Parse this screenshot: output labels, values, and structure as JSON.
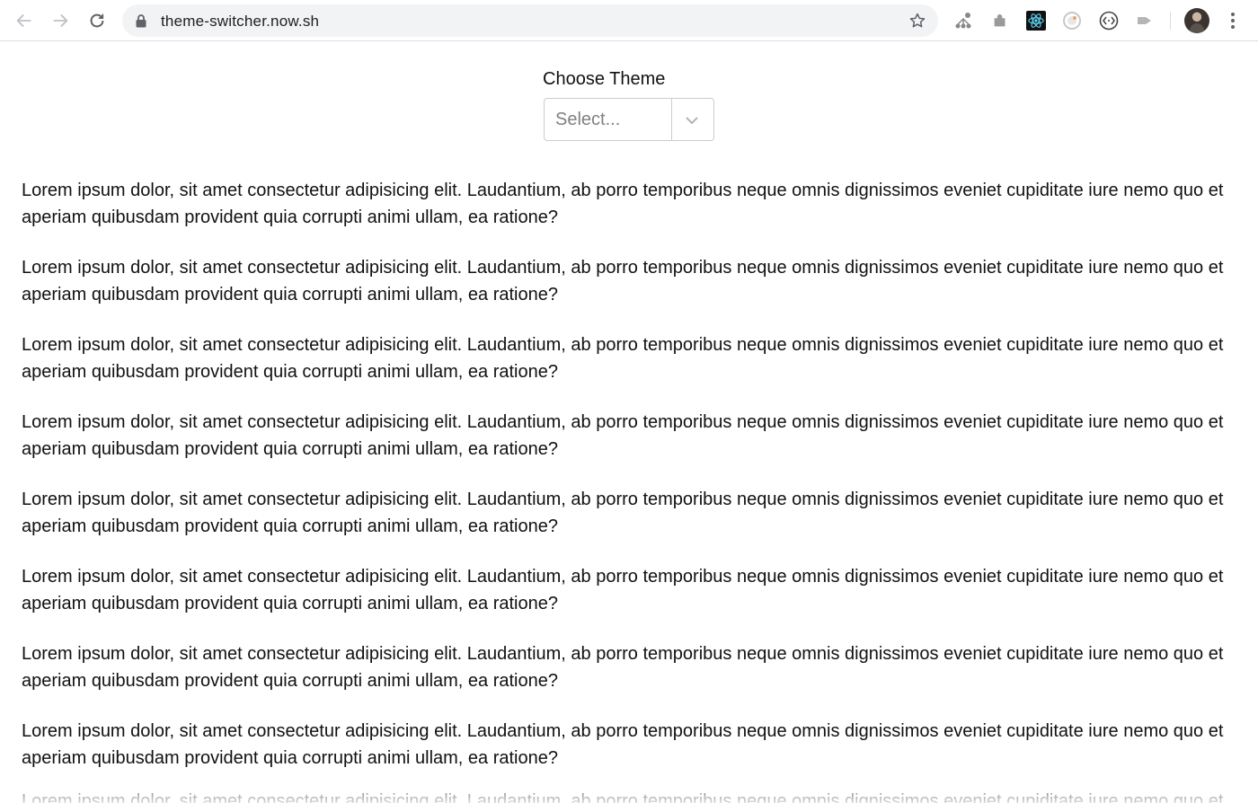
{
  "browser": {
    "url": "theme-switcher.now.sh",
    "icons": {
      "back": "back-arrow-icon",
      "forward": "forward-arrow-icon",
      "reload": "reload-icon",
      "lock": "lock-icon",
      "bookmark": "star-icon",
      "menu": "more-vertical-icon"
    },
    "extensions": [
      "extension-network-icon",
      "extension-puzzle-icon",
      "react-devtools-icon",
      "extension-circle-icon",
      "extension-code-icon",
      "extension-arrow-icon"
    ]
  },
  "theme_picker": {
    "label": "Choose Theme",
    "placeholder": "Select..."
  },
  "content": {
    "paragraphs": [
      "Lorem ipsum dolor, sit amet consectetur adipisicing elit. Laudantium, ab porro temporibus neque omnis dignissimos eveniet cupiditate iure nemo quo et aperiam quibusdam provident quia corrupti animi ullam, ea ratione?",
      "Lorem ipsum dolor, sit amet consectetur adipisicing elit. Laudantium, ab porro temporibus neque omnis dignissimos eveniet cupiditate iure nemo quo et aperiam quibusdam provident quia corrupti animi ullam, ea ratione?",
      "Lorem ipsum dolor, sit amet consectetur adipisicing elit. Laudantium, ab porro temporibus neque omnis dignissimos eveniet cupiditate iure nemo quo et aperiam quibusdam provident quia corrupti animi ullam, ea ratione?",
      "Lorem ipsum dolor, sit amet consectetur adipisicing elit. Laudantium, ab porro temporibus neque omnis dignissimos eveniet cupiditate iure nemo quo et aperiam quibusdam provident quia corrupti animi ullam, ea ratione?",
      "Lorem ipsum dolor, sit amet consectetur adipisicing elit. Laudantium, ab porro temporibus neque omnis dignissimos eveniet cupiditate iure nemo quo et aperiam quibusdam provident quia corrupti animi ullam, ea ratione?",
      "Lorem ipsum dolor, sit amet consectetur adipisicing elit. Laudantium, ab porro temporibus neque omnis dignissimos eveniet cupiditate iure nemo quo et aperiam quibusdam provident quia corrupti animi ullam, ea ratione?",
      "Lorem ipsum dolor, sit amet consectetur adipisicing elit. Laudantium, ab porro temporibus neque omnis dignissimos eveniet cupiditate iure nemo quo et aperiam quibusdam provident quia corrupti animi ullam, ea ratione?",
      "Lorem ipsum dolor, sit amet consectetur adipisicing elit. Laudantium, ab porro temporibus neque omnis dignissimos eveniet cupiditate iure nemo quo et aperiam quibusdam provident quia corrupti animi ullam, ea ratione?",
      "Lorem ipsum dolor, sit amet consectetur adipisicing elit. Laudantium, ab porro temporibus neque omnis dignissimos eveniet cupiditate iure nemo quo et aperiam quibusdam provident quia corrupti animi ullam, ea ratione?"
    ]
  },
  "colors": {
    "chrome_background": "#ffffff",
    "omnibox_background": "#f1f3f4",
    "icon_gray": "#5f6368",
    "text": "#111111",
    "placeholder": "#808080",
    "select_border": "#cccccc"
  }
}
